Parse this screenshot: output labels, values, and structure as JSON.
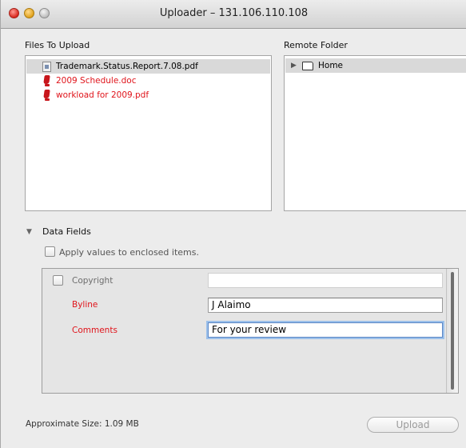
{
  "window": {
    "title": "Uploader – 131.106.110.108"
  },
  "files_pane": {
    "label": "Files To Upload",
    "items": [
      {
        "name": "Trademark.Status.Report.7.08.pdf",
        "icon": "document-icon",
        "selected": true,
        "error": false
      },
      {
        "name": "2009 Schedule.doc",
        "icon": "warning-icon",
        "selected": false,
        "error": true
      },
      {
        "name": "workload for 2009.pdf",
        "icon": "warning-icon",
        "selected": false,
        "error": true
      }
    ]
  },
  "remote_pane": {
    "label": "Remote Folder",
    "items": [
      {
        "name": "Home",
        "icon": "folder-icon"
      }
    ]
  },
  "data_fields": {
    "label": "Data Fields",
    "apply_label": "Apply values to enclosed items.",
    "apply_checked": false,
    "fields": [
      {
        "label": "Copyright",
        "value": "",
        "required": false,
        "has_checkbox": true,
        "checked": false
      },
      {
        "label": "Byline",
        "value": "J Alaimo",
        "required": true
      },
      {
        "label": "Comments",
        "value": "For your review",
        "required": true,
        "focused": true
      }
    ]
  },
  "footer": {
    "size_text": "Approximate Size: 1.09 MB",
    "upload_label": "Upload",
    "upload_enabled": false
  },
  "colors": {
    "error_red": "#e0141b",
    "window_bg": "#ececec",
    "selection_gray": "#d9d9d9",
    "focus_ring": "#9cc0ea"
  }
}
